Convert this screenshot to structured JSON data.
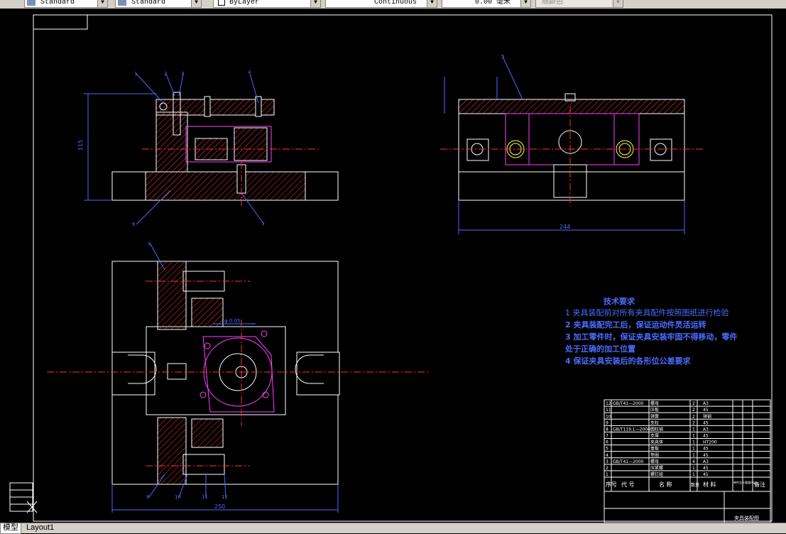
{
  "toolbar": {
    "text_style": "Standard",
    "dim_style": "Standard",
    "layer": "ByLayer",
    "linetype": "Continuous",
    "lineweight": "0.00 毫米",
    "plot_style": "随颜色"
  },
  "tabs": {
    "model": "模型",
    "layout1": "Layout1"
  },
  "colors": {
    "outline": "#ffffff",
    "hatch": "#ff3b3b",
    "magenta": "#ff40ff",
    "centerline": "#ff3030",
    "dimension": "#4a6cff",
    "part": "#ffff40"
  },
  "drawing": {
    "dimensions": {
      "front_height": "115",
      "side_width": "244",
      "plan_width": "250",
      "bore": "φ 0.05"
    },
    "front_view_balloons": [
      "1",
      "2",
      "3",
      "4",
      "6",
      "7"
    ],
    "side_view_balloons": [
      "5"
    ],
    "plan_view_balloons": [
      "8",
      "9",
      "10",
      "11",
      "12"
    ]
  },
  "tech_requirements": {
    "title": "技术要求",
    "items": [
      "1  夹具装配前对所有夹具配件按照图纸进行检验",
      "2  夹具装配完工后，保证运动件灵活运转",
      "3  加工零件时，保证夹具安装牢固不得移动，零件",
      "   处于正确的加工位置",
      "4  保证夹具安装后的各形位公差要求"
    ]
  },
  "bom": {
    "rows": [
      {
        "no": "12",
        "code": "GB/T41—2000",
        "name": "螺母",
        "qty": "2",
        "material": "A3"
      },
      {
        "no": "11",
        "code": "",
        "name": "压板",
        "qty": "2",
        "material": "45"
      },
      {
        "no": "10",
        "code": "",
        "name": "弹簧",
        "qty": "2",
        "material": "弹钢"
      },
      {
        "no": "9",
        "code": "",
        "name": "支柱",
        "qty": "2",
        "material": "45"
      },
      {
        "no": "8",
        "code": "GB/T119.1—2000",
        "name": "圆柱销",
        "qty": "1",
        "material": "A3"
      },
      {
        "no": "7",
        "code": "",
        "name": "支撑",
        "qty": "1",
        "material": "45"
      },
      {
        "no": "6",
        "code": "",
        "name": "夹具体",
        "qty": "1",
        "material": "HT200"
      },
      {
        "no": "5",
        "code": "",
        "name": "盖板",
        "qty": "1",
        "material": "45"
      },
      {
        "no": "4",
        "code": "",
        "name": "垫圈",
        "qty": "1",
        "material": "45"
      },
      {
        "no": "3",
        "code": "GB/T41—2000",
        "name": "螺母",
        "qty": "4",
        "material": "A3"
      },
      {
        "no": "2",
        "code": "",
        "name": "压紧螺",
        "qty": "1",
        "material": "45"
      },
      {
        "no": "1",
        "code": "",
        "name": "螺钉组",
        "qty": "1",
        "material": "45"
      }
    ],
    "header": [
      "序号",
      "代  号",
      "名  称",
      "数量",
      "材  料",
      "单件总计重量(kg)",
      "备注"
    ],
    "title_block": "夹具装配图"
  }
}
